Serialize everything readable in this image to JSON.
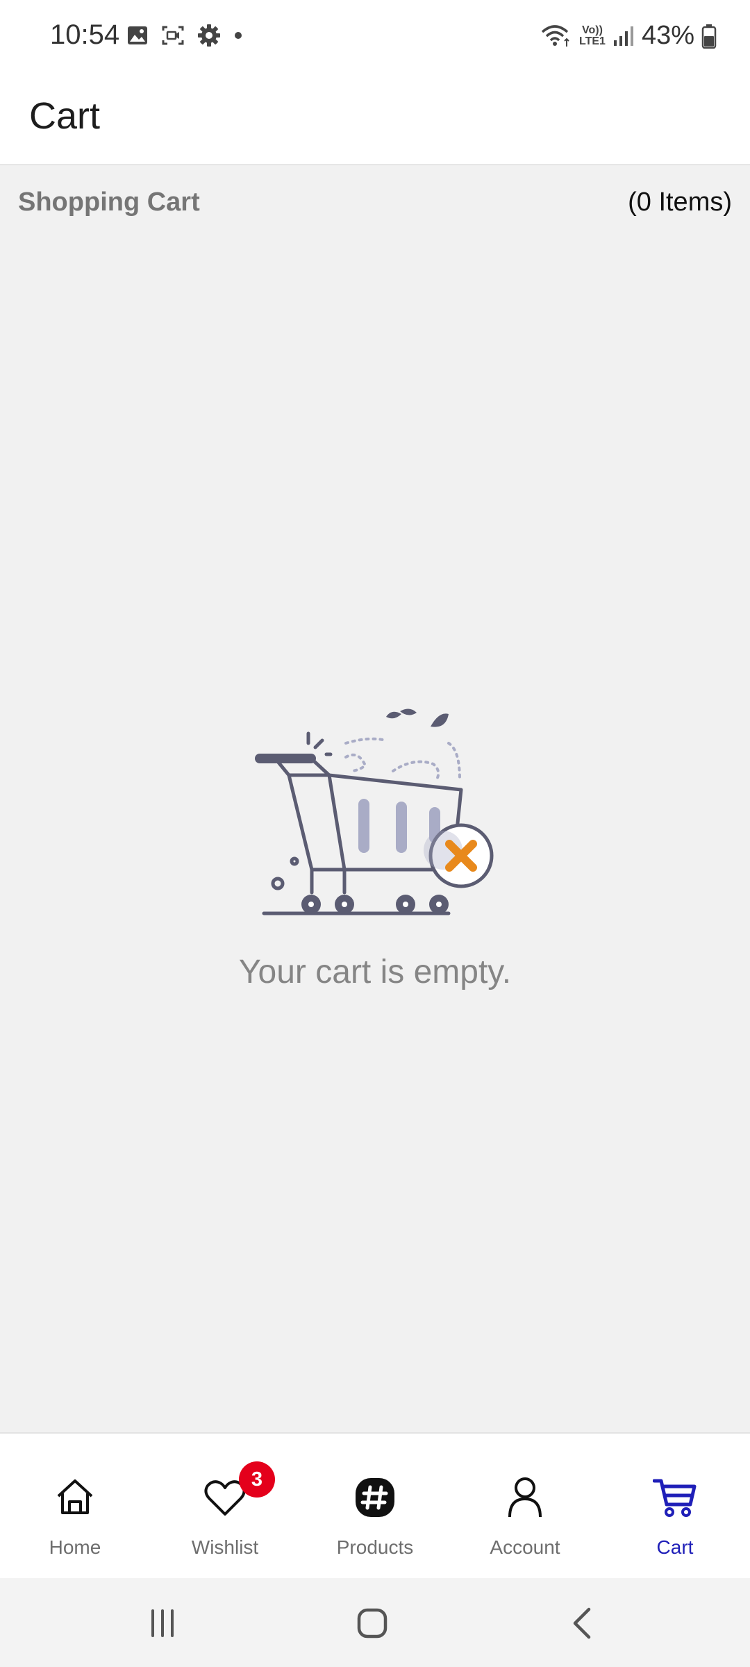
{
  "status_bar": {
    "time": "10:54",
    "battery_percent": "43%",
    "icons_left": [
      "gallery-icon",
      "screen-record-icon",
      "settings-gear-icon",
      "dot-icon"
    ],
    "icons_right": [
      "wifi-icon",
      "volte-lte1-icon",
      "signal-icon",
      "battery-icon"
    ],
    "volte_text": "Vo))",
    "lte_text": "LTE1"
  },
  "app_bar": {
    "title": "Cart"
  },
  "cart_header": {
    "title": "Shopping Cart",
    "count": "(0 Items)"
  },
  "empty_state": {
    "message": "Your cart is empty.",
    "icon": "empty-cart-illustration"
  },
  "bottom_nav": {
    "items": [
      {
        "label": "Home",
        "icon": "home-icon"
      },
      {
        "label": "Wishlist",
        "icon": "heart-icon",
        "badge": "3"
      },
      {
        "label": "Products",
        "icon": "products-hash-icon"
      },
      {
        "label": "Account",
        "icon": "person-icon"
      },
      {
        "label": "Cart",
        "icon": "cart-icon",
        "active": true
      }
    ]
  },
  "colors": {
    "active": "#1f1fb8",
    "badge": "#e4001b",
    "illustration_accent": "#e8891c",
    "illustration_line": "#5b5c72"
  }
}
